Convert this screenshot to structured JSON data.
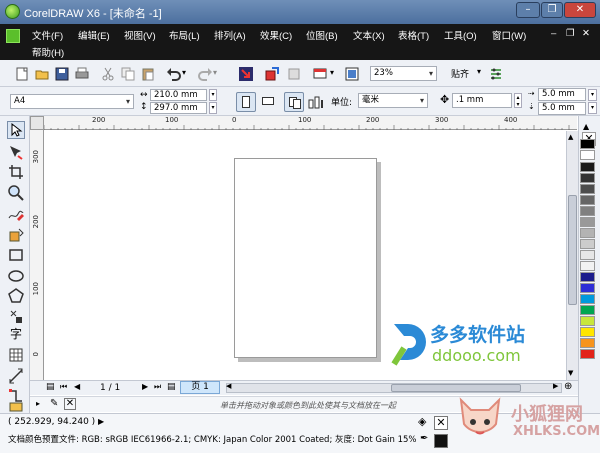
{
  "window": {
    "title": "CorelDRAW X6 - [未命名 -1]",
    "minimize": "–",
    "restore": "❐",
    "close": "✕"
  },
  "menu": {
    "items": [
      "文件(F)",
      "编辑(E)",
      "视图(V)",
      "布局(L)",
      "排列(A)",
      "效果(C)",
      "位图(B)",
      "文本(X)",
      "表格(T)",
      "工具(O)",
      "窗口(W)"
    ],
    "help": "帮助(H)",
    "right_controls": [
      "–",
      "❐",
      "✕"
    ]
  },
  "standard_toolbar": {
    "zoom_value": "23%",
    "snap_label": "贴齐",
    "icons": [
      "new-icon",
      "open-icon",
      "save-icon",
      "print-icon",
      "cut-icon",
      "copy-icon",
      "paste-icon",
      "undo-icon",
      "redo-icon",
      "import-icon",
      "export-icon",
      "app-launcher-icon",
      "full-screen-icon",
      "options-icon"
    ]
  },
  "property_bar": {
    "paper_size": "A4",
    "width": "210.0 mm",
    "height": "297.0 mm",
    "units_label": "单位:",
    "units_value": "毫米",
    "nudge": ".1 mm",
    "dup_x": "5.0 mm",
    "dup_y": "5.0 mm"
  },
  "ruler": {
    "top_ticks": [
      "200",
      "100",
      "0",
      "100",
      "200",
      "300",
      "400"
    ],
    "left_ticks": [
      "300",
      "200",
      "100",
      "0"
    ]
  },
  "page_nav": {
    "counter": "1 / 1",
    "tab": "页 1"
  },
  "hint": "单击并拖动对象或颜色到此处使其与文档放在一起",
  "status": {
    "coords": "( 252.929, 94.240 )",
    "color_profile": "文档颜色预置文件: RGB: sRGB IEC61966-2.1; CMYK: Japan Color 2001 Coated; 灰度: Dot Gain 15%"
  },
  "palette": [
    "#ffffff",
    "#000000",
    "#1a1a1a",
    "#333333",
    "#4d4d4d",
    "#666666",
    "#808080",
    "#999999",
    "#b3b3b3",
    "#cccccc",
    "#e6e6e6",
    "#f2f2f2",
    "#1c1c8c",
    "#2e2ed6",
    "#0099dd",
    "#00a651",
    "#c8e63c",
    "#ffe600",
    "#f7941d",
    "#e2231a"
  ],
  "watermarks": {
    "brand1": "多多软件站",
    "brand1_url": "ddooo.com",
    "brand2": "小狐狸网",
    "brand2_url": "XHLKS.COM"
  }
}
